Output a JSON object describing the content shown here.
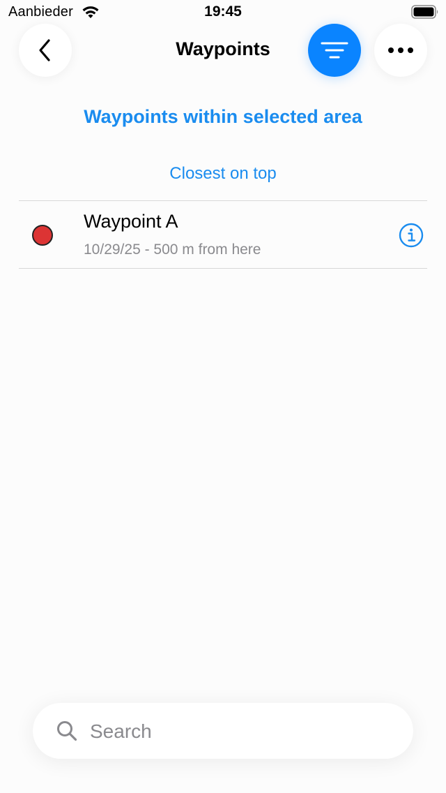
{
  "status_bar": {
    "carrier": "Aanbieder",
    "time": "19:45"
  },
  "nav": {
    "title": "Waypoints",
    "back_icon": "chevron-left-icon",
    "filter_icon": "filter-lines-icon",
    "more_icon": "ellipsis-icon"
  },
  "section": {
    "title": "Waypoints within selected area",
    "sort_label": "Closest on top"
  },
  "waypoints": [
    {
      "name": "Waypoint A",
      "detail": "10/29/25 - 500 m from here",
      "color": "#dc3434"
    }
  ],
  "search": {
    "placeholder": "Search",
    "value": ""
  },
  "colors": {
    "accent": "#1a8cef",
    "filter_button": "#0a84ff"
  }
}
